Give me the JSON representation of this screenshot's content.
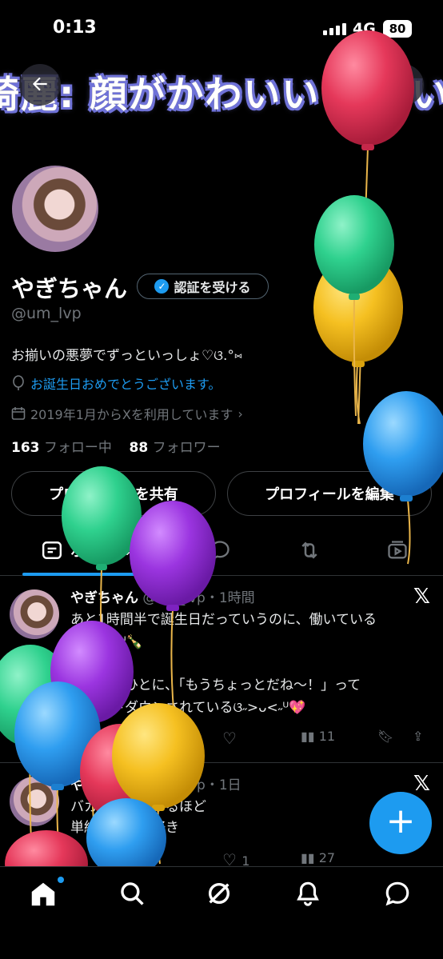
{
  "status_bar": {
    "time": "0:13",
    "network": "4G",
    "battery": "80"
  },
  "banner": {
    "text": "綺麗: 顔がかわいい 優しい 好"
  },
  "profile": {
    "name": "やぎちゃん",
    "verify_label": "認証を受ける",
    "handle": "@um_lvp",
    "bio": "お揃いの悪夢でずっといっしょ♡ଓ.°⑅",
    "birthday_text": "お誕生日おめでとうございます。",
    "joined_text": "2019年1月からXを利用しています",
    "following_count": "163",
    "following_label": "フォロー中",
    "followers_count": "88",
    "followers_label": "フォロワー",
    "share_label": "プロフィールを共有",
    "edit_label": "プロフィールを編集"
  },
  "tabs": {
    "posts_label": "ポスト"
  },
  "posts": [
    {
      "name": "やぎちゃん",
      "meta": "@um_lvp・1時間",
      "lines": [
        "あと1時間半で誕生日だっていうのに、働いている",
        "ଓ˶>ᴗ<˶ᵁ🍾",
        "",
        "いろんなひとに、「もうちょっとだね〜！」って",
        "カウントダウンされているଓ˶>ᴗ<˶ᵁ💖"
      ],
      "views": "11"
    },
    {
      "name": "やぎちゃん",
      "meta": "@um_lvp・1日",
      "lines": [
        "バカ　　　わかるほど",
        "単純　　　は好き"
      ],
      "likes": "1",
      "views": "27"
    }
  ],
  "fab": {
    "label": "+"
  }
}
